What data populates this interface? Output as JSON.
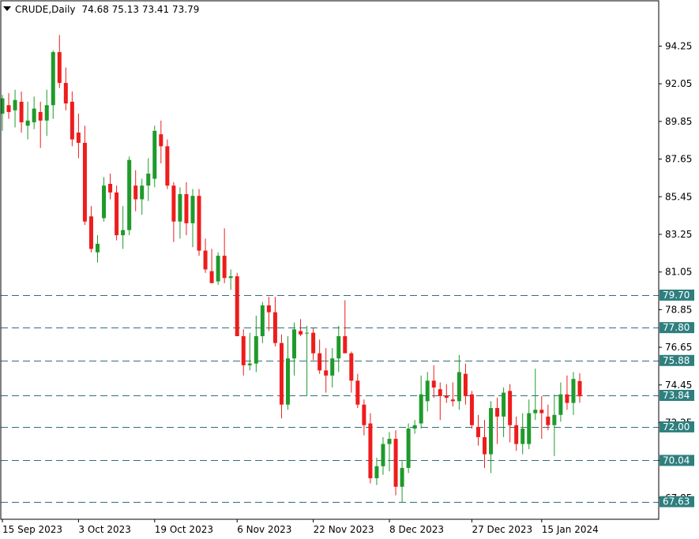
{
  "header": {
    "symbol": "CRUDE,Daily",
    "ohlc": "74.68 75.13 73.41 73.79"
  },
  "colors": {
    "bull": "#1f9a2b",
    "bear": "#ee1c1c",
    "level_line": "#2f6f7a",
    "level_label_bg": "#2f7f7f",
    "frame": "#000000"
  },
  "chart_data": {
    "type": "candlestick",
    "ylim": [
      66.6,
      96.9
    ],
    "y_ticks": [
      "94.25",
      "92.05",
      "89.85",
      "87.65",
      "85.45",
      "83.25",
      "81.05",
      "78.85",
      "76.65",
      "74.45",
      "72.25",
      "70.05",
      "67.85"
    ],
    "x_tick_labels": [
      {
        "label": "15 Sep 2023",
        "index": 0
      },
      {
        "label": "3 Oct 2023",
        "index": 12
      },
      {
        "label": "19 Oct 2023",
        "index": 24
      },
      {
        "label": "6 Nov 2023",
        "index": 37
      },
      {
        "label": "22 Nov 2023",
        "index": 49
      },
      {
        "label": "8 Dec 2023",
        "index": 61
      },
      {
        "label": "27 Dec 2023",
        "index": 74
      },
      {
        "label": "15 Jan 2024",
        "index": 85
      }
    ],
    "horizontal_levels": [
      {
        "label": "79.70",
        "value": 79.7
      },
      {
        "label": "77.80",
        "value": 77.8
      },
      {
        "label": "75.88",
        "value": 75.88
      },
      {
        "label": "73.84",
        "value": 73.84
      },
      {
        "label": "72.00",
        "value": 72.0
      },
      {
        "label": "70.04",
        "value": 70.04
      },
      {
        "label": "67.63",
        "value": 67.63
      }
    ],
    "candles": [
      [
        90.3,
        91.4,
        89.3,
        91.2
      ],
      [
        90.8,
        91.5,
        90.0,
        90.4
      ],
      [
        90.5,
        91.7,
        89.5,
        91.1
      ],
      [
        91.0,
        91.6,
        89.2,
        89.8
      ],
      [
        89.6,
        91.0,
        88.8,
        89.9
      ],
      [
        89.8,
        91.3,
        89.4,
        90.6
      ],
      [
        90.4,
        91.0,
        88.3,
        89.9
      ],
      [
        89.9,
        91.7,
        89.0,
        90.8
      ],
      [
        90.8,
        94.0,
        90.0,
        93.9
      ],
      [
        93.9,
        94.9,
        91.8,
        92.1
      ],
      [
        92.1,
        93.0,
        90.5,
        90.9
      ],
      [
        91.0,
        91.6,
        88.4,
        88.8
      ],
      [
        89.2,
        90.3,
        87.7,
        88.6
      ],
      [
        88.6,
        89.6,
        83.8,
        84.0
      ],
      [
        84.3,
        84.9,
        82.2,
        82.4
      ],
      [
        82.2,
        83.2,
        81.6,
        82.7
      ],
      [
        84.2,
        86.6,
        84.0,
        86.1
      ],
      [
        86.2,
        86.8,
        85.3,
        85.7
      ],
      [
        85.7,
        86.1,
        82.9,
        83.2
      ],
      [
        83.2,
        84.9,
        82.4,
        83.5
      ],
      [
        83.5,
        87.8,
        83.2,
        87.6
      ],
      [
        86.1,
        87.0,
        84.6,
        85.3
      ],
      [
        85.3,
        86.5,
        84.4,
        86.1
      ],
      [
        86.1,
        87.7,
        85.2,
        86.8
      ],
      [
        86.5,
        89.6,
        86.0,
        89.3
      ],
      [
        89.1,
        89.9,
        87.4,
        88.4
      ],
      [
        88.4,
        88.8,
        85.9,
        86.1
      ],
      [
        86.1,
        86.3,
        82.8,
        84.0
      ],
      [
        84.0,
        86.0,
        83.0,
        85.6
      ],
      [
        85.6,
        86.3,
        83.2,
        83.9
      ],
      [
        83.9,
        85.9,
        82.5,
        85.5
      ],
      [
        85.5,
        85.9,
        82.0,
        82.3
      ],
      [
        82.3,
        83.0,
        81.0,
        81.2
      ],
      [
        81.1,
        82.4,
        80.4,
        80.4
      ],
      [
        80.5,
        82.2,
        80.3,
        82.0
      ],
      [
        82.0,
        83.6,
        80.4,
        80.7
      ],
      [
        80.7,
        81.2,
        80.0,
        80.8
      ],
      [
        80.8,
        81.0,
        77.3,
        77.3
      ],
      [
        77.3,
        77.7,
        75.0,
        75.6
      ],
      [
        75.6,
        77.5,
        75.3,
        75.7
      ],
      [
        75.7,
        78.5,
        75.2,
        77.3
      ],
      [
        77.3,
        79.3,
        76.9,
        79.1
      ],
      [
        79.1,
        79.6,
        77.6,
        78.7
      ],
      [
        78.7,
        79.6,
        76.7,
        76.9
      ],
      [
        76.9,
        77.4,
        72.5,
        73.3
      ],
      [
        73.3,
        77.3,
        73.0,
        76.0
      ],
      [
        76.0,
        78.1,
        75.0,
        77.7
      ],
      [
        77.6,
        78.3,
        77.3,
        77.4
      ],
      [
        77.5,
        77.9,
        73.8,
        77.5
      ],
      [
        77.5,
        77.8,
        75.9,
        76.3
      ],
      [
        76.3,
        77.1,
        75.1,
        75.3
      ],
      [
        75.3,
        76.6,
        74.0,
        75.0
      ],
      [
        75.0,
        76.6,
        74.3,
        76.0
      ],
      [
        76.0,
        77.9,
        75.2,
        77.3
      ],
      [
        77.3,
        79.4,
        76.8,
        76.3
      ],
      [
        76.3,
        76.4,
        74.0,
        74.7
      ],
      [
        74.7,
        75.1,
        73.1,
        73.3
      ],
      [
        73.3,
        73.6,
        71.5,
        72.1
      ],
      [
        72.2,
        72.8,
        68.7,
        69.0
      ],
      [
        69.0,
        70.2,
        68.6,
        69.7
      ],
      [
        69.7,
        71.4,
        69.2,
        71.0
      ],
      [
        71.0,
        71.7,
        69.4,
        71.3
      ],
      [
        71.3,
        71.8,
        68.0,
        68.5
      ],
      [
        68.5,
        70.0,
        67.6,
        69.6
      ],
      [
        69.6,
        72.2,
        69.3,
        71.9
      ],
      [
        71.9,
        72.4,
        71.6,
        72.1
      ],
      [
        72.2,
        75.0,
        71.9,
        73.9
      ],
      [
        73.5,
        75.2,
        72.9,
        74.7
      ],
      [
        74.7,
        75.6,
        73.7,
        74.3
      ],
      [
        74.2,
        74.6,
        72.4,
        73.8
      ],
      [
        73.8,
        74.5,
        73.4,
        73.7
      ],
      [
        73.6,
        74.6,
        73.2,
        73.5
      ],
      [
        73.5,
        76.2,
        73.0,
        75.2
      ],
      [
        75.1,
        75.7,
        73.3,
        73.8
      ],
      [
        73.9,
        74.1,
        71.9,
        72.1
      ],
      [
        72.0,
        72.7,
        70.9,
        71.4
      ],
      [
        71.4,
        72.4,
        69.6,
        70.4
      ],
      [
        70.4,
        73.5,
        69.3,
        73.1
      ],
      [
        73.1,
        73.7,
        71.0,
        72.6
      ],
      [
        72.6,
        74.3,
        71.4,
        74.0
      ],
      [
        74.1,
        74.5,
        71.1,
        72.1
      ],
      [
        72.1,
        72.6,
        70.6,
        71.0
      ],
      [
        71.0,
        72.8,
        70.4,
        71.9
      ],
      [
        71.0,
        73.6,
        70.7,
        72.8
      ],
      [
        72.8,
        75.4,
        72.4,
        73.0
      ],
      [
        73.0,
        73.8,
        71.3,
        72.8
      ],
      [
        72.6,
        73.3,
        71.8,
        72.1
      ],
      [
        72.1,
        73.9,
        70.3,
        72.7
      ],
      [
        72.7,
        74.6,
        72.3,
        73.9
      ],
      [
        73.9,
        75.0,
        73.0,
        73.4
      ],
      [
        73.4,
        75.2,
        72.7,
        74.8
      ],
      [
        74.68,
        75.13,
        73.41,
        73.79
      ]
    ]
  }
}
